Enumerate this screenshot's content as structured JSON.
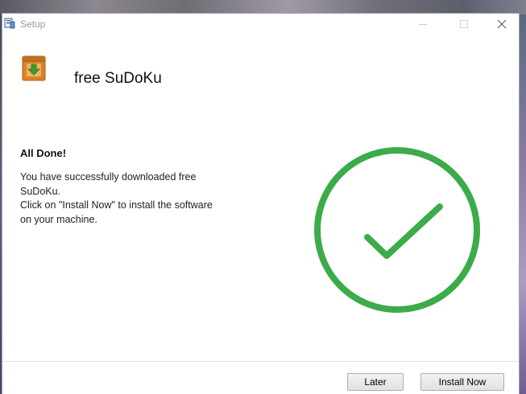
{
  "window": {
    "title": "Setup",
    "controls": {
      "minimize": "minimize-icon",
      "maximize": "maximize-icon",
      "close": "close-icon"
    }
  },
  "header": {
    "app_name": "free SuDoKu",
    "icon": "download-box-icon"
  },
  "content": {
    "heading": "All Done!",
    "lines": [
      "You have successfully downloaded free",
      "SuDoKu.",
      "Click on \"Install Now\" to install the software",
      "on your machine."
    ],
    "status_icon": "checkmark-circle-icon"
  },
  "footer": {
    "later_label": "Later",
    "install_label": "Install Now"
  },
  "colors": {
    "success_green": "#3cab4a",
    "icon_orange": "#d9822b"
  }
}
